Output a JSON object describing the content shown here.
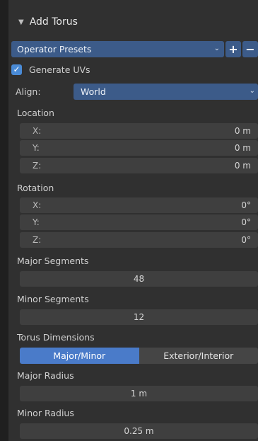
{
  "panel": {
    "title": "Add Torus",
    "presets_label": "Operator Presets",
    "presets_add": "+",
    "presets_remove": "−",
    "generate_uvs_label": "Generate UVs",
    "generate_uvs_checked": true,
    "align_label": "Align:",
    "align_value": "World",
    "location_label": "Location",
    "location": [
      {
        "axis": "X:",
        "value": "0 m"
      },
      {
        "axis": "Y:",
        "value": "0 m"
      },
      {
        "axis": "Z:",
        "value": "0 m"
      }
    ],
    "rotation_label": "Rotation",
    "rotation": [
      {
        "axis": "X:",
        "value": "0°"
      },
      {
        "axis": "Y:",
        "value": "0°"
      },
      {
        "axis": "Z:",
        "value": "0°"
      }
    ],
    "major_segments_label": "Major Segments",
    "major_segments_value": "48",
    "minor_segments_label": "Minor Segments",
    "minor_segments_value": "12",
    "torus_dimensions_label": "Torus Dimensions",
    "dimensions_mode_options": [
      "Major/Minor",
      "Exterior/Interior"
    ],
    "major_radius_label": "Major Radius",
    "major_radius_value": "1 m",
    "minor_radius_label": "Minor Radius",
    "minor_radius_value": "0.25 m"
  },
  "colors": {
    "accent_blue": "#4a7bc9",
    "select_blue": "#3c5b89",
    "checkbox_blue": "#4a8bd6",
    "panel_bg": "#303030",
    "field_bg": "#3f3f3f"
  },
  "icons": {
    "collapse": "triangle-down-icon",
    "dropdown": "chevron-down-icon",
    "checkmark": "checkmark-icon"
  }
}
